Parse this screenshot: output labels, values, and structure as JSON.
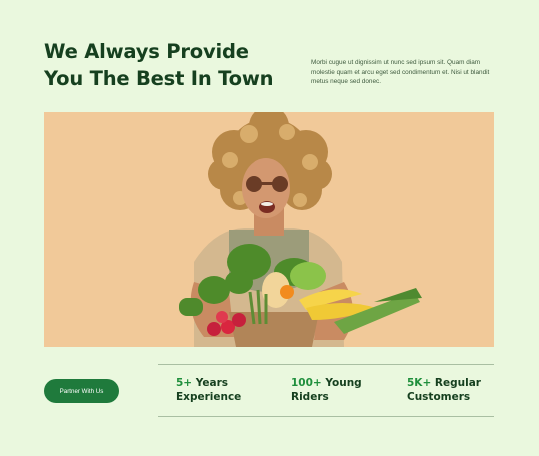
{
  "hero_section": {
    "title_line1": "We Always Provide",
    "title_line2": "You The Best In Town",
    "description": "Morbi cugue ut dignissim ut nunc sed ipsum sit. Quam diam molestie quam et arcu eget sed condimentum et. Nisi ut blandit metus neque sed donec."
  },
  "cta": {
    "partner_label": "Partner With Us"
  },
  "stats": [
    {
      "number": "5+",
      "line1": "Years",
      "line2": "Experience"
    },
    {
      "number": "100+",
      "line1": "Young",
      "line2": "Riders"
    },
    {
      "number": "5K+",
      "line1": "Regular",
      "line2": "Customers"
    }
  ],
  "colors": {
    "background": "#eaf8de",
    "heading": "#16401f",
    "accent_green": "#1f8f3c",
    "button": "#1f7a3c",
    "photo_backdrop": "#f1c999"
  }
}
